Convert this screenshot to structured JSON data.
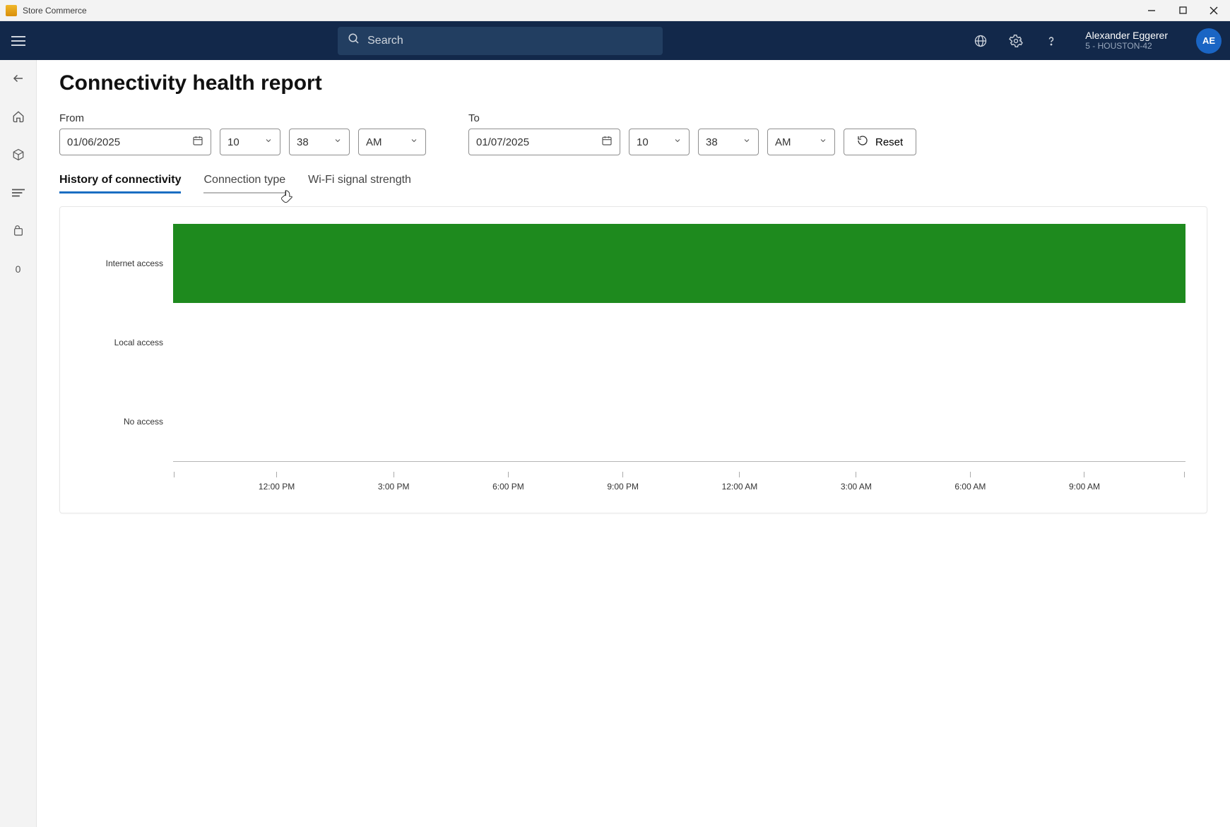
{
  "window": {
    "app_title": "Store Commerce"
  },
  "header": {
    "search_placeholder": "Search",
    "user_name": "Alexander Eggerer",
    "user_sub": "5 - HOUSTON-42",
    "avatar_initials": "AE"
  },
  "sidebar": {
    "zero_label": "0"
  },
  "page": {
    "title": "Connectivity health report",
    "from_label": "From",
    "to_label": "To",
    "from_date": "01/06/2025",
    "from_hour": "10",
    "from_min": "38",
    "from_ampm": "AM",
    "to_date": "01/07/2025",
    "to_hour": "10",
    "to_min": "38",
    "to_ampm": "AM",
    "reset_label": "Reset"
  },
  "tabs": {
    "history": "History of connectivity",
    "connection": "Connection type",
    "wifi": "Wi-Fi signal strength"
  },
  "chart_data": {
    "type": "bar",
    "orientation": "horizontal",
    "categories": [
      "Internet access",
      "Local access",
      "No access"
    ],
    "series": [
      {
        "name": "coverage",
        "values": [
          100,
          0,
          0
        ]
      }
    ],
    "x_ticks": [
      "12:00 PM",
      "3:00 PM",
      "6:00 PM",
      "9:00 PM",
      "12:00 AM",
      "3:00 AM",
      "6:00 AM",
      "9:00 AM"
    ],
    "xlabel": "",
    "ylabel": "",
    "ylim": [
      0,
      100
    ],
    "title": ""
  }
}
